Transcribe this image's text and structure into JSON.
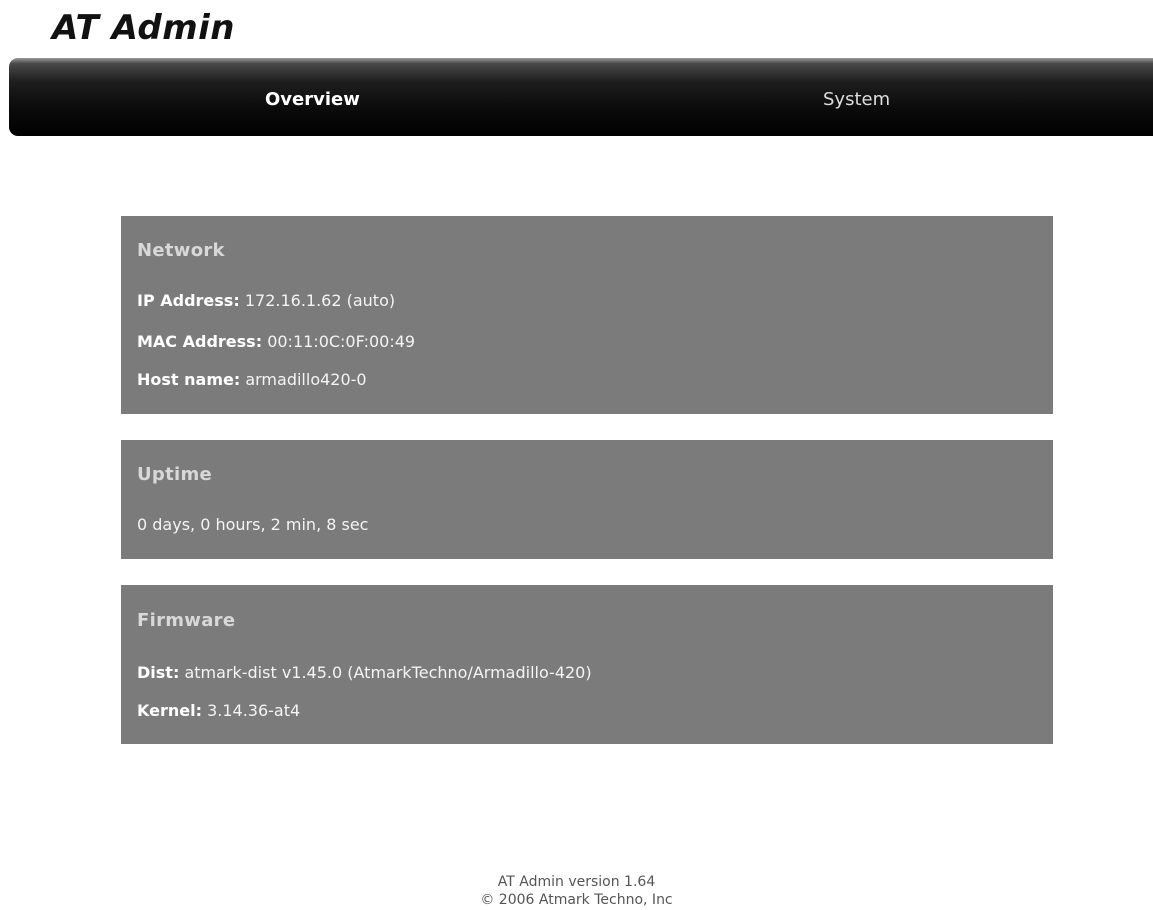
{
  "app": {
    "title": "AT Admin"
  },
  "nav": {
    "tabs": [
      {
        "label": "Overview",
        "active": true
      },
      {
        "label": "System",
        "active": false
      }
    ]
  },
  "network": {
    "heading": "Network",
    "ip_label": "IP Address:",
    "ip_value": "172.16.1.62 (auto)",
    "mac_label": "MAC Address:",
    "mac_value": "00:11:0C:0F:00:49",
    "host_label": "Host name:",
    "host_value": "armadillo420-0"
  },
  "uptime": {
    "heading": "Uptime",
    "value": "0 days, 0 hours, 2 min, 8 sec"
  },
  "firmware": {
    "heading": "Firmware",
    "dist_label": "Dist:",
    "dist_value": "atmark-dist v1.45.0 (AtmarkTechno/Armadillo-420)",
    "kernel_label": "Kernel:",
    "kernel_value": "3.14.36-at4"
  },
  "footer": {
    "version": "AT Admin version 1.64",
    "copyright": "© 2006 Atmark Techno, Inc"
  },
  "colors": {
    "panel_bg": "#7b7b7b",
    "nav_bg": "#000000",
    "page_bg": "#ffffff"
  }
}
